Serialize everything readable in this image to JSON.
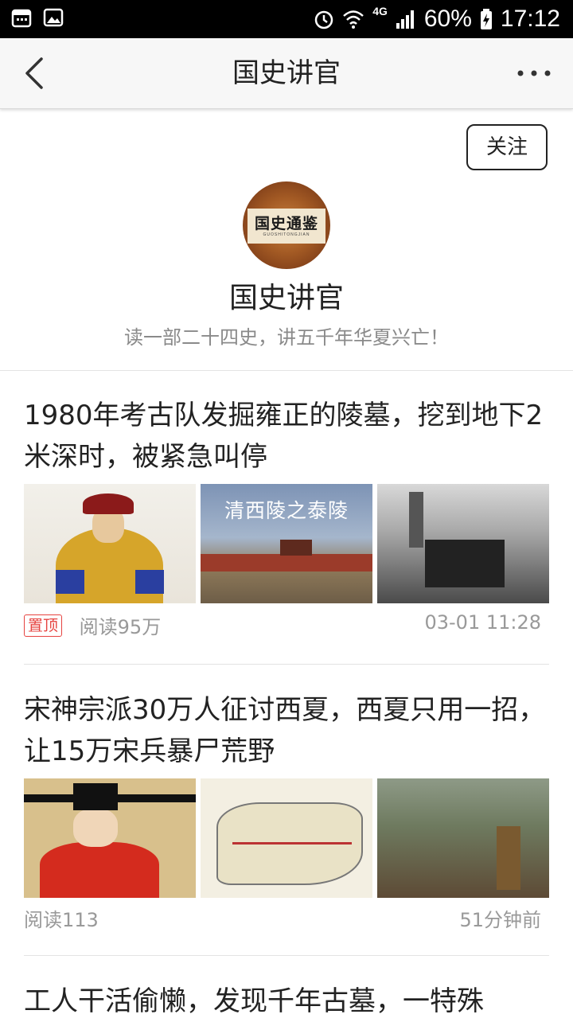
{
  "status_bar": {
    "network": "4G",
    "battery": "60%",
    "time": "17:12"
  },
  "nav": {
    "title": "国史讲官"
  },
  "profile": {
    "follow_label": "关注",
    "avatar_text": "国史通鉴",
    "avatar_subtext": "GUOSHITONGJIAN",
    "name": "国史讲官",
    "description": "读一部二十四史，讲五千年华夏兴亡！"
  },
  "articles": [
    {
      "title": "1980年考古队发掘雍正的陵墓，挖到地下2米深时，被紧急叫停",
      "thumb_caption": "清西陵之泰陵",
      "pinned_label": "置顶",
      "reads": "阅读95万",
      "time": "03-01 11:28"
    },
    {
      "title": "宋神宗派30万人征讨西夏，西夏只用一招，让15万宋兵暴尸荒野",
      "reads": "阅读113",
      "time": "51分钟前"
    },
    {
      "title": "工人干活偷懒，发现千年古墓，一特殊"
    }
  ]
}
